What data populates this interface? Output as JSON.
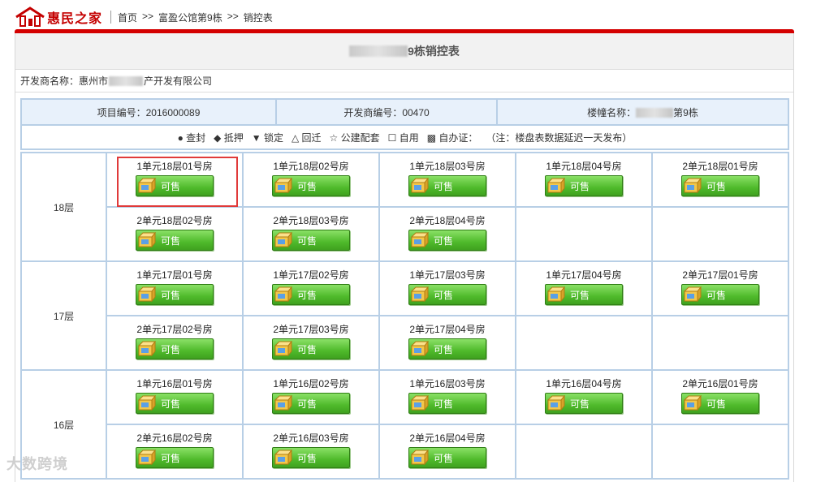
{
  "header": {
    "logo_text": "惠民之家",
    "breadcrumb": [
      "首页",
      ">>",
      "富盈公馆第9栋",
      ">>",
      "销控表"
    ]
  },
  "title": {
    "suffix": "9栋销控表"
  },
  "developer": {
    "prefix": "开发商名称：惠州市",
    "suffix": "产开发有限公司"
  },
  "info": {
    "project_no": "项目编号：2016000089",
    "developer_no": "开发商编号：00470",
    "building_prefix": "楼幢名称：",
    "building_suffix": "第9栋"
  },
  "legend": {
    "items": [
      "● 查封",
      "◆ 抵押",
      "▼ 锁定",
      "△ 回迁",
      "☆ 公建配套",
      "☐ 自用",
      "▩ 自办证：",
      "（注：楼盘表数据延迟一天发布）"
    ]
  },
  "status_label": "可售",
  "floors": [
    {
      "label": "18层",
      "rows": [
        [
          "1单元18层01号房",
          "1单元18层02号房",
          "1单元18层03号房",
          "1单元18层04号房",
          "2单元18层01号房"
        ],
        [
          "2单元18层02号房",
          "2单元18层03号房",
          "2单元18层04号房",
          "",
          ""
        ]
      ]
    },
    {
      "label": "17层",
      "rows": [
        [
          "1单元17层01号房",
          "1单元17层02号房",
          "1单元17层03号房",
          "1单元17层04号房",
          "2单元17层01号房"
        ],
        [
          "2单元17层02号房",
          "2单元17层03号房",
          "2单元17层04号房",
          "",
          ""
        ]
      ]
    },
    {
      "label": "16层",
      "rows": [
        [
          "1单元16层01号房",
          "1单元16层02号房",
          "1单元16层03号房",
          "1单元16层04号房",
          "2单元16层01号房"
        ],
        [
          "2单元16层02号房",
          "2单元16层03号房",
          "2单元16层04号房",
          "",
          ""
        ]
      ]
    }
  ],
  "watermark": "大数跨境"
}
